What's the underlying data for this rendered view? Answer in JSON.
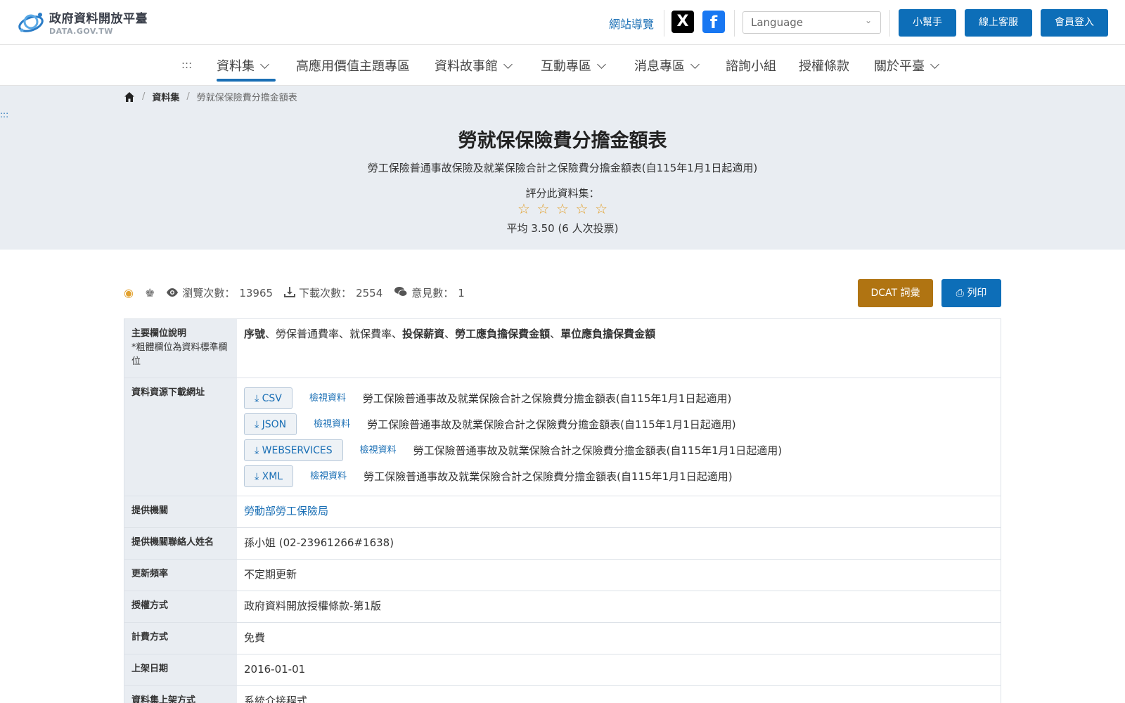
{
  "header": {
    "logo_title": "政府資料開放平臺",
    "logo_sub": "DATA.GOV.TW",
    "sitemap": "網站導覽",
    "x_icon": "X",
    "fb_icon": "f",
    "language_placeholder": "Language",
    "buttons": [
      "小幫手",
      "線上客服",
      "會員登入"
    ]
  },
  "nav": {
    "accesskey": ":::",
    "items": [
      "資料集",
      "高應用價值主題專區",
      "資料故事館",
      "互動專區",
      "消息專區",
      "諮詢小組",
      "授權條款",
      "關於平臺"
    ]
  },
  "breadcrumb": {
    "items": [
      "資料集",
      "勞就保保險費分擔金額表"
    ]
  },
  "hero": {
    "accesskey": ":::",
    "title": "勞就保保險費分擔金額表",
    "description": "勞工保險普通事故保險及就業保險合計之保險費分擔金額表(自115年1月1日起適用)",
    "rate_label": "評分此資料集：",
    "rating": {
      "value": 3.5,
      "votes": 6,
      "max": 5
    },
    "avg_text": "平均 3.50 (6 人次投票)"
  },
  "stats": {
    "views_label": "瀏覽次數：",
    "views": "13965",
    "downloads_label": "下載次數：",
    "downloads": "2554",
    "comments_label": "意見數：",
    "comments": "1"
  },
  "actions": {
    "dcat": "DCAT 詞彙",
    "print": "列印"
  },
  "table": {
    "fields_label": "主要欄位說明",
    "fields_note": "*粗體欄位為資料標準欄位",
    "fields": [
      {
        "text": "序號",
        "bold": true
      },
      {
        "text": "、",
        "bold": false
      },
      {
        "text": "勞保普通費率",
        "bold": false
      },
      {
        "text": "、",
        "bold": false
      },
      {
        "text": "就保費率",
        "bold": false
      },
      {
        "text": "、",
        "bold": false
      },
      {
        "text": "投保薪資",
        "bold": true
      },
      {
        "text": "、",
        "bold": false
      },
      {
        "text": "勞工應負擔保費金額",
        "bold": true
      },
      {
        "text": "、",
        "bold": false
      },
      {
        "text": "單位應負擔保費金額",
        "bold": true
      }
    ],
    "download_label": "資料資源下載網址",
    "resources": [
      {
        "format": "CSV",
        "view": "檢視資料",
        "title": "勞工保險普通事故及就業保險合計之保險費分擔金額表(自115年1月1日起適用)"
      },
      {
        "format": "JSON",
        "view": "檢視資料",
        "title": "勞工保險普通事故及就業保險合計之保險費分擔金額表(自115年1月1日起適用)"
      },
      {
        "format": "WEBSERVICES",
        "view": "檢視資料",
        "title": "勞工保險普通事故及就業保險合計之保險費分擔金額表(自115年1月1日起適用)"
      },
      {
        "format": "XML",
        "view": "檢視資料",
        "title": "勞工保險普通事故及就業保險合計之保險費分擔金額表(自115年1月1日起適用)"
      }
    ],
    "rows": [
      {
        "label": "提供機關",
        "value": "勞動部勞工保險局",
        "link": true
      },
      {
        "label": "提供機關聯絡人姓名",
        "value": "孫小姐 (02-23961266#1638)",
        "link": false
      },
      {
        "label": "更新頻率",
        "value": "不定期更新",
        "link": false
      },
      {
        "label": "授權方式",
        "value": "政府資料開放授權條款-第1版",
        "link": false
      },
      {
        "label": "計費方式",
        "value": "免費",
        "link": false
      },
      {
        "label": "上架日期",
        "value": "2016-01-01",
        "link": false
      },
      {
        "label": "資料集上架方式",
        "value": "系統介接程式",
        "link": false
      }
    ]
  }
}
